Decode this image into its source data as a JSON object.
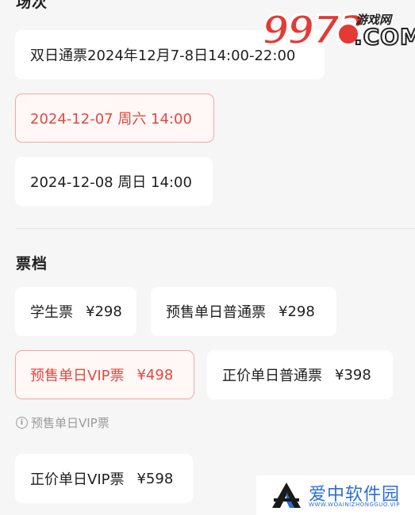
{
  "sessions": {
    "title_partial": "场次",
    "options": [
      {
        "label": "双日通票2024年12月7-8日14:00-22:00"
      },
      {
        "label": "2024-12-07 周六 14:00",
        "selected": true
      },
      {
        "label": "2024-12-08 周日 14:00"
      }
    ]
  },
  "tickets": {
    "title": "票档",
    "options": [
      {
        "name": "学生票",
        "price": "¥298"
      },
      {
        "name": "预售单日普通票",
        "price": "¥298"
      },
      {
        "name": "预售单日VIP票",
        "price": "¥498",
        "selected": true
      },
      {
        "name": "正价单日普通票",
        "price": "¥398"
      },
      {
        "name": "正价单日VIP票",
        "price": "¥598"
      }
    ],
    "selected_note": "预售单日VIP票"
  },
  "watermarks": {
    "top_digits": "9973",
    "top_small": "游戏网",
    "top_com": ".COM",
    "bottom_brand": "爱中软件园",
    "bottom_url": "WWW.WOAINIZHONGGUO.VIP"
  },
  "colors": {
    "accent": "#e5483e",
    "accent_border": "#f3a7a0",
    "background": "#f6f6f6",
    "chip": "#ffffff"
  }
}
